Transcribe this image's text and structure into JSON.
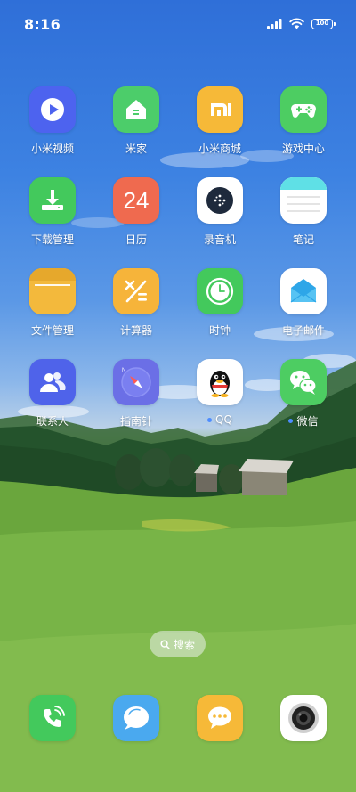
{
  "status_bar": {
    "time": "8:16",
    "battery": "100",
    "icons": [
      "signal-icon",
      "wifi-icon",
      "battery-icon"
    ]
  },
  "apps": [
    {
      "label": "小米视频",
      "icon": "video-play-icon",
      "color": "#4d63ef"
    },
    {
      "label": "米家",
      "icon": "home-icon",
      "color": "#4ccd6a"
    },
    {
      "label": "小米商城",
      "icon": "mi-store-icon",
      "color": "#f6b938"
    },
    {
      "label": "游戏中心",
      "icon": "gamepad-icon",
      "color": "#4dcd62"
    },
    {
      "label": "下载管理",
      "icon": "download-icon",
      "color": "#43c95c"
    },
    {
      "label": "日历",
      "icon": "calendar-icon",
      "color": "#ef6a4f",
      "badge_text": "24"
    },
    {
      "label": "录音机",
      "icon": "recorder-icon",
      "color": "#ffffff"
    },
    {
      "label": "笔记",
      "icon": "notes-icon",
      "color": "#ffffff"
    },
    {
      "label": "文件管理",
      "icon": "folder-icon",
      "color": "#f3b93c"
    },
    {
      "label": "计算器",
      "icon": "calculator-icon",
      "color": "#f6b43a"
    },
    {
      "label": "时钟",
      "icon": "clock-icon",
      "color": "#43c95c"
    },
    {
      "label": "电子邮件",
      "icon": "mail-icon",
      "color": "#ffffff"
    },
    {
      "label": "联系人",
      "icon": "contacts-icon",
      "color": "#4f63ea"
    },
    {
      "label": "指南针",
      "icon": "compass-icon",
      "color": "#6b6fe6"
    },
    {
      "label": "QQ",
      "icon": "qq-penguin-icon",
      "color": "#ffffff",
      "new_dot": true
    },
    {
      "label": "微信",
      "icon": "wechat-icon",
      "color": "#4dcd62",
      "new_dot": true
    }
  ],
  "search": {
    "label": "搜索",
    "icon": "search-icon"
  },
  "dock": [
    {
      "icon": "phone-icon",
      "color": "#43c95c"
    },
    {
      "icon": "browser-bubble-icon",
      "color": "#4aa9ef"
    },
    {
      "icon": "messages-icon",
      "color": "#f6b938"
    },
    {
      "icon": "camera-icon",
      "color": "#ffffff"
    }
  ]
}
